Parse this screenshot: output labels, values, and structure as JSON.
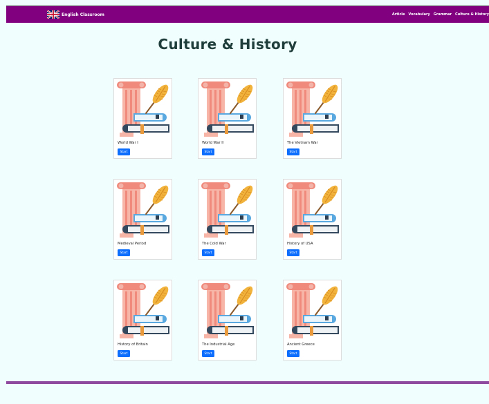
{
  "brand": {
    "name": "English Classroom",
    "icon": "uk-flag-icon"
  },
  "nav": [
    "Article",
    "Vocabulary",
    "Grammar",
    "Culture & History"
  ],
  "page": {
    "title": "Culture & History"
  },
  "cards": [
    {
      "title": "World War I",
      "button": "Start"
    },
    {
      "title": "World War II",
      "button": "Start"
    },
    {
      "title": "The Vietnam War",
      "button": "Start"
    },
    {
      "title": "Medieval Period",
      "button": "Start"
    },
    {
      "title": "The Cold War",
      "button": "Start"
    },
    {
      "title": "History of USA",
      "button": "Start"
    },
    {
      "title": "History of Britain",
      "button": "Start"
    },
    {
      "title": "The Industrial Age",
      "button": "Start"
    },
    {
      "title": "Ancient Greece",
      "button": "Start"
    }
  ],
  "colors": {
    "navbar": "#800080",
    "background": "#f0fffe",
    "button": "#0d6efd",
    "footer": "#8e4a9e",
    "title": "#1f3d3a"
  }
}
